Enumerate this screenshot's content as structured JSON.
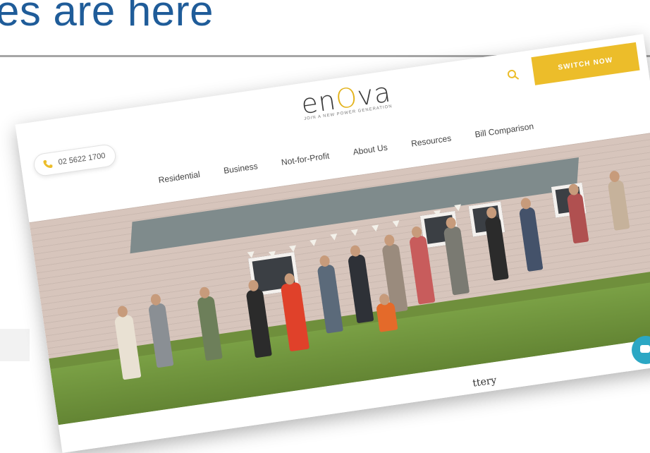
{
  "slide": {
    "title": "es are here"
  },
  "site": {
    "phone": "02 5622 1700",
    "logo": {
      "text_left": "en",
      "text_o": "O",
      "text_right": "va",
      "tagline": "JOIN A NEW POWER GENERATION"
    },
    "switch_button": "SWITCH NOW",
    "nav": [
      "Residential",
      "Business",
      "Not-for-Profit",
      "About Us",
      "Resources",
      "Bill Comparison"
    ],
    "below_fold_text": "ttery"
  },
  "colors": {
    "accent": "#ecbd2a",
    "title": "#1f5c99",
    "chat": "#2ba7c4"
  },
  "icons": {
    "phone": "phone-icon",
    "search": "search-icon",
    "chat": "chat-icon"
  }
}
